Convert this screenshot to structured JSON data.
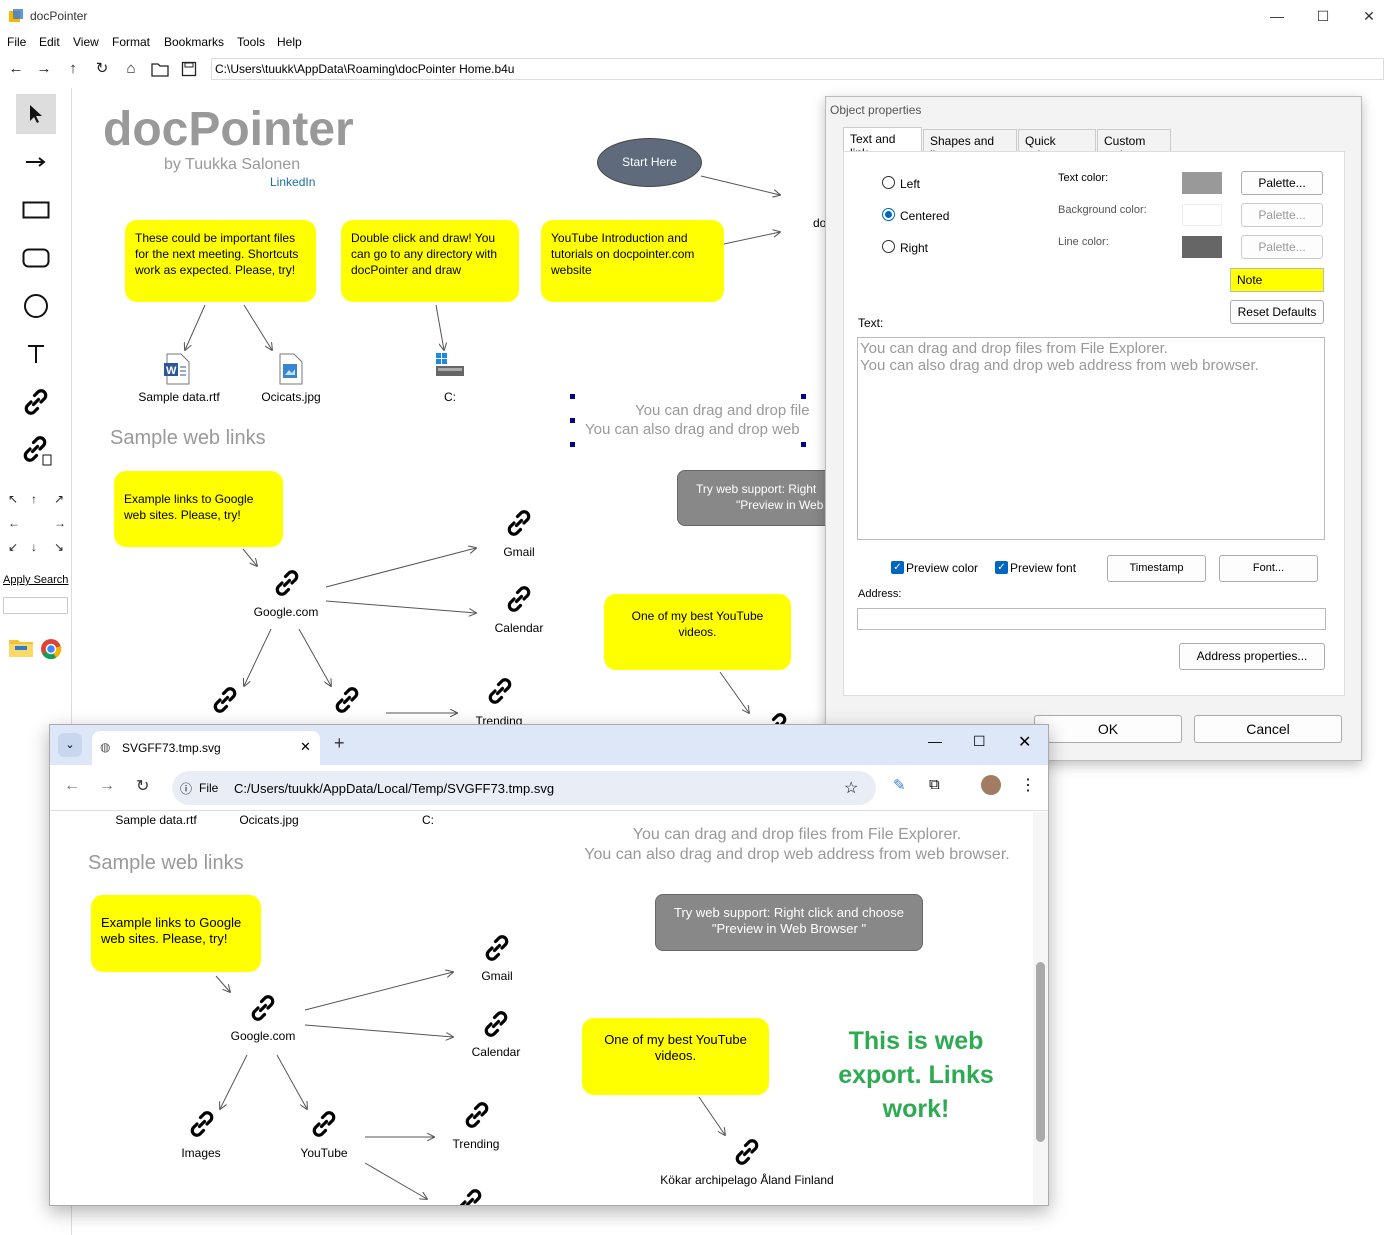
{
  "window": {
    "title": "docPointer"
  },
  "menu": [
    "File",
    "Edit",
    "View",
    "Format",
    "Bookmarks",
    "Tools",
    "Help"
  ],
  "path": "C:\\Users\\tuukk\\AppData\\Roaming\\docPointer Home.b4u",
  "sidebar": {
    "apply_search": "Apply Search",
    "search_value": ""
  },
  "canvas": {
    "title": "docPointer",
    "subtitle": "by Tuukka Salonen",
    "linkedin": "LinkedIn",
    "start_here": "Start Here",
    "doc_partial": "do",
    "note1": "These could be important files for the next meeting. Shortcuts work as expected. Please, try!",
    "note2": "Double click and draw! You can go to any directory with docPointer and draw",
    "note3": "YouTube Introduction and tutorials on docpointer.com website",
    "file1": "Sample data.rtf",
    "file2": "Ocicats.jpg",
    "file3": "C:",
    "sample_web_links": "Sample web links",
    "drag_line1": "You can drag and drop file",
    "drag_line2": "You can also drag and drop web",
    "note_google": "Example links to Google web sites. Please, try!",
    "gmail": "Gmail",
    "google": "Google.com",
    "calendar": "Calendar",
    "trending": "Trending",
    "web_support_1": "Try web support: Right",
    "web_support_2": "\"Preview in Web",
    "youtube_note": "One of my best YouTube videos."
  },
  "dialog": {
    "title": "Object properties",
    "tabs": [
      "Text and link",
      "Shapes and line",
      "Quick colors",
      "Custom xml"
    ],
    "align": [
      "Left",
      "Centered",
      "Right"
    ],
    "text_color": "Text color:",
    "bg_color": "Background color:",
    "line_color": "Line color:",
    "palette": "Palette...",
    "note_btn": "Note",
    "reset": "Reset Defaults",
    "text_label": "Text:",
    "text_value": "You can drag and drop files from File Explorer.\nYou can also drag and drop web address from web browser.",
    "preview_color": "Preview color",
    "preview_font": "Preview font",
    "timestamp": "Timestamp",
    "font": "Font...",
    "address": "Address:",
    "address_value": "",
    "address_props": "Address properties...",
    "ok": "OK",
    "cancel": "Cancel",
    "colors": {
      "text": "#999999",
      "background": "#ffffff",
      "line": "#666666",
      "note": "#ffff00"
    }
  },
  "browser": {
    "tab_title": "SVGFF73.tmp.svg",
    "file_chip": "File",
    "url": "C:/Users/tuukk/AppData/Local/Temp/SVGFF73.tmp.svg",
    "content": {
      "file1": "Sample data.rtf",
      "file2": "Ocicats.jpg",
      "file3": "C:",
      "drag_line1": "You can drag and drop files from File Explorer.",
      "drag_line2": "You can also drag and drop web address from web browser.",
      "sample_web_links": "Sample web links",
      "note_google": "Example links to Google web sites. Please, try!",
      "web_support": "Try web support: Right click and choose \"Preview in Web Browser \"",
      "gmail": "Gmail",
      "google": "Google.com",
      "calendar": "Calendar",
      "youtube_note": "One of my best YouTube videos.",
      "export_text": "This is web export. Links work!",
      "images": "Images",
      "youtube": "YouTube",
      "trending": "Trending",
      "kokar": "Kökar archipelago Åland Finland"
    }
  }
}
